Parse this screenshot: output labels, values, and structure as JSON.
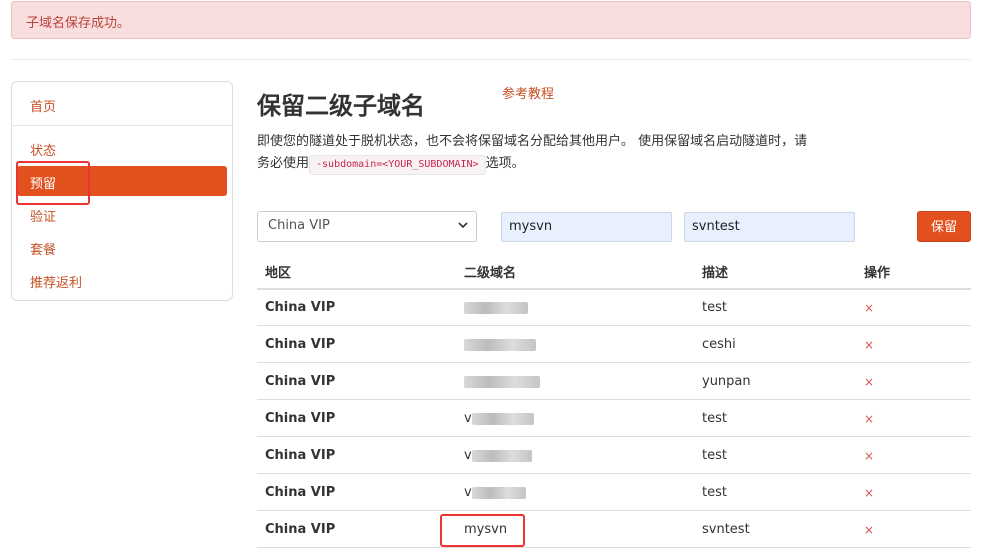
{
  "alert": {
    "message": "子域名保存成功。"
  },
  "sidebar": {
    "items": [
      {
        "label": "首页"
      },
      {
        "label": "状态"
      },
      {
        "label": "预留"
      },
      {
        "label": "验证"
      },
      {
        "label": "套餐"
      },
      {
        "label": "推荐返利"
      }
    ],
    "active": "预留"
  },
  "main": {
    "title": "保留二级子域名",
    "ref_link": "参考教程",
    "description_part1": "即使您的隧道处于脱机状态，也不会将保留域名分配给其他用户。 使用保留域名启动隧道时，请务必使用",
    "description_code": "-subdomain=<YOUR_SUBDOMAIN>",
    "description_part2": "选项。"
  },
  "form": {
    "region_selected": "China VIP",
    "subdomain_value": "mysvn",
    "description_value": "svntest",
    "save_label": "保留"
  },
  "table": {
    "headers": [
      "地区",
      "二级域名",
      "描述",
      "操作"
    ],
    "rows": [
      {
        "region": "China VIP",
        "subdomain": "",
        "description": "test",
        "action": "×"
      },
      {
        "region": "China VIP",
        "subdomain": "",
        "description": "ceshi",
        "action": "×"
      },
      {
        "region": "China VIP",
        "subdomain": "",
        "description": "yunpan",
        "action": "×"
      },
      {
        "region": "China VIP",
        "subdomain": "v",
        "description": "test",
        "action": "×"
      },
      {
        "region": "China VIP",
        "subdomain": "v",
        "description": "test",
        "action": "×"
      },
      {
        "region": "China VIP",
        "subdomain": "v",
        "description": "test",
        "action": "×"
      },
      {
        "region": "China VIP",
        "subdomain": "mysvn",
        "description": "svntest",
        "action": "×"
      }
    ]
  },
  "colors": {
    "accent": "#e2501e",
    "alert_bg": "#f8dede",
    "alert_text": "#b8433a",
    "highlight": "#ee3333"
  }
}
